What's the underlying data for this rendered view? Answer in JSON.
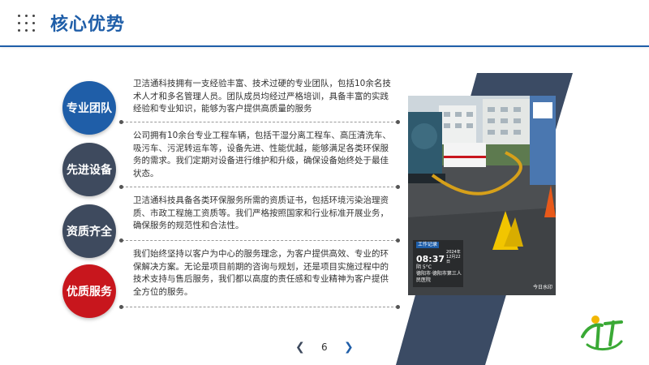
{
  "header": {
    "title": "核心优势"
  },
  "advantages": [
    {
      "label": "专业团队",
      "text": "卫洁通科技拥有一支经验丰富、技术过硬的专业团队，包括10余名技术人才和多名管理人员。团队成员均经过严格培训，具备丰富的实践经验和专业知识，能够为客户提供高质量的服务",
      "color": "#1f5ea8"
    },
    {
      "label": "先进设备",
      "text": "公司拥有10余台专业工程车辆，包括干湿分离工程车、高压清洗车、吸污车、污泥转运车等，设备先进、性能优越，能够满足各类环保服务的需求。我们定期对设备进行维护和升级，确保设备始终处于最佳状态。",
      "color": "#3e4a5e"
    },
    {
      "label": "资质齐全",
      "text": "卫洁通科技具备各类环保服务所需的资质证书，包括环境污染治理资质、市政工程施工资质等。我们严格按照国家和行业标准开展业务，确保服务的规范性和合法性。",
      "color": "#3e4a5e"
    },
    {
      "label": "优质服务",
      "text": "我们始终坚持以客户为中心的服务理念，为客户提供高效、专业的环保解决方案。无论是项目前期的咨询与规划，还是项目实施过程中的技术支持与售后服务，我们都以高度的责任感和专业精神为客户提供全方位的服务。",
      "color": "#c8161d"
    }
  ],
  "photo_overlay": {
    "badge": "工作记录",
    "time": "08:37",
    "date": "2024年12月22日",
    "weather": "阴 5°C",
    "location": "德阳市·德阳市第三人民医院",
    "watermark": "今日水印"
  },
  "pagination": {
    "prev_icon": "chevron-left-icon",
    "page": "6",
    "next_icon": "chevron-right-icon"
  },
  "colors": {
    "brand_blue": "#1f5ea8",
    "slate": "#3e4a5e",
    "red": "#c8161d",
    "logo_green": "#3aa935"
  }
}
